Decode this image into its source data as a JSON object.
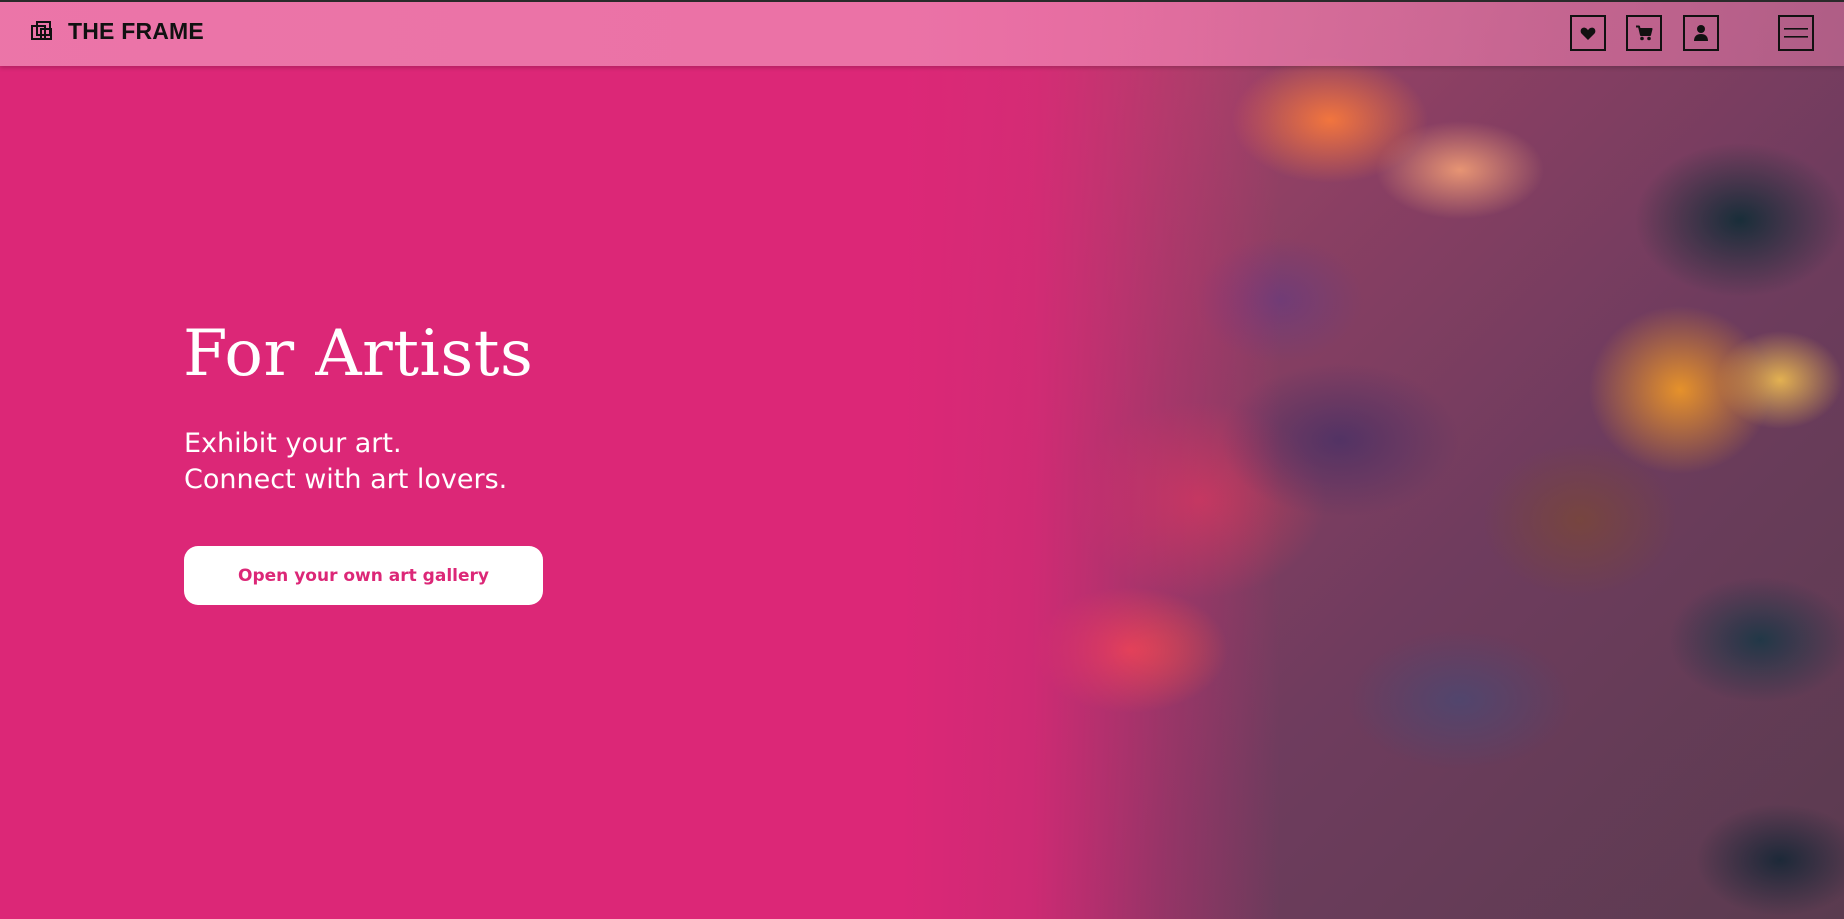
{
  "brand": {
    "name": "THE FRAME",
    "icon": "overlapping-frames-icon"
  },
  "header": {
    "actions": [
      {
        "name": "wishlist",
        "icon": "heart-icon"
      },
      {
        "name": "cart",
        "icon": "cart-icon"
      },
      {
        "name": "account",
        "icon": "user-icon"
      },
      {
        "name": "menu",
        "icon": "hamburger-icon"
      }
    ]
  },
  "hero": {
    "title": "For Artists",
    "subtitle_line1": "Exhibit your art.",
    "subtitle_line2": "Connect with art lovers.",
    "cta_label": "Open your own art gallery"
  },
  "colors": {
    "brand_pink": "#dc2777",
    "header_pink": "#ec78aa",
    "white": "#ffffff",
    "ink": "#111111"
  }
}
